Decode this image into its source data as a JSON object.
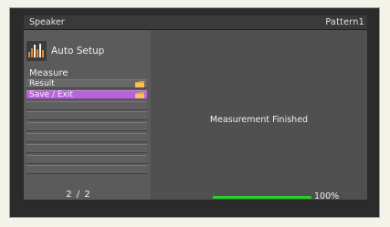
{
  "top_bar": {
    "title": "Speaker",
    "pattern": "Pattern1"
  },
  "left_panel": {
    "setup_label": "Auto Setup",
    "section_label": "Measure",
    "items": [
      {
        "label": "Result",
        "icon": "folder-icon",
        "selected": false
      },
      {
        "label": "Save / Exit",
        "icon": "folder-icon",
        "selected": true
      },
      {
        "label": ""
      },
      {
        "label": ""
      },
      {
        "label": ""
      },
      {
        "label": ""
      },
      {
        "label": ""
      },
      {
        "label": ""
      },
      {
        "label": ""
      }
    ],
    "page_indicator": "2 / 2"
  },
  "right_panel": {
    "status_message": "Measurement Finished",
    "progress": {
      "value": 1.0,
      "label": "100%"
    }
  },
  "colors": {
    "selected": "#b565d6",
    "progress": "#22d12a",
    "screen_bg": "#545454"
  }
}
